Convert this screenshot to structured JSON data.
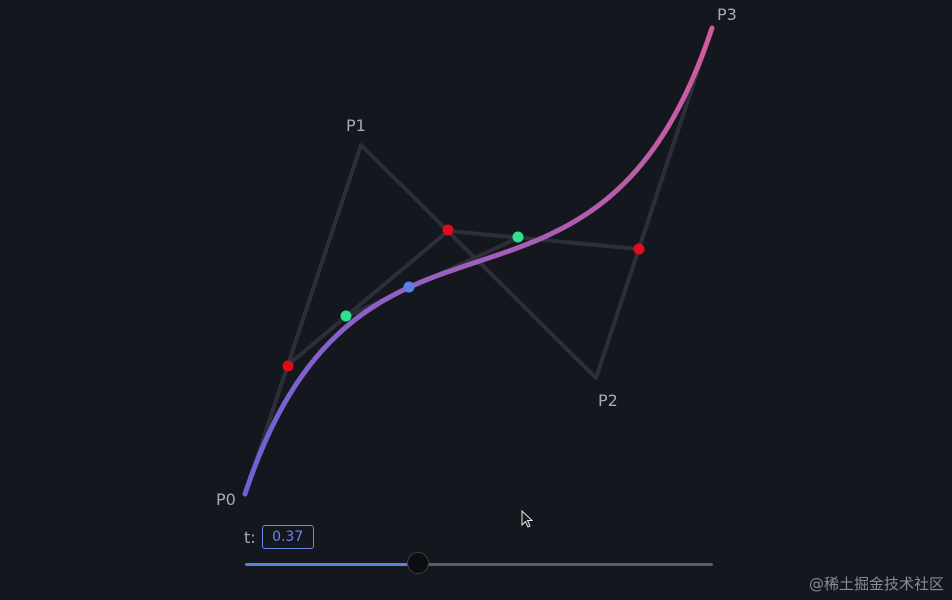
{
  "points": {
    "p0_label": "P0",
    "p1_label": "P1",
    "p2_label": "P2",
    "p3_label": "P3"
  },
  "control": {
    "t_label": "t:",
    "t_value": "0.37",
    "t": 0.37
  },
  "colors": {
    "background": "#15171e",
    "hull": "#2d2f38",
    "curve_start": "#6a63d8",
    "curve_end": "#d45b9c",
    "level1_points": "#e10b1b",
    "level2_points": "#2fe08f",
    "curve_point": "#5b80e6",
    "slider_fill": "#5b80e6",
    "slider_track": "#5c5e66"
  },
  "watermark": "@稀土掘金技术社区"
}
